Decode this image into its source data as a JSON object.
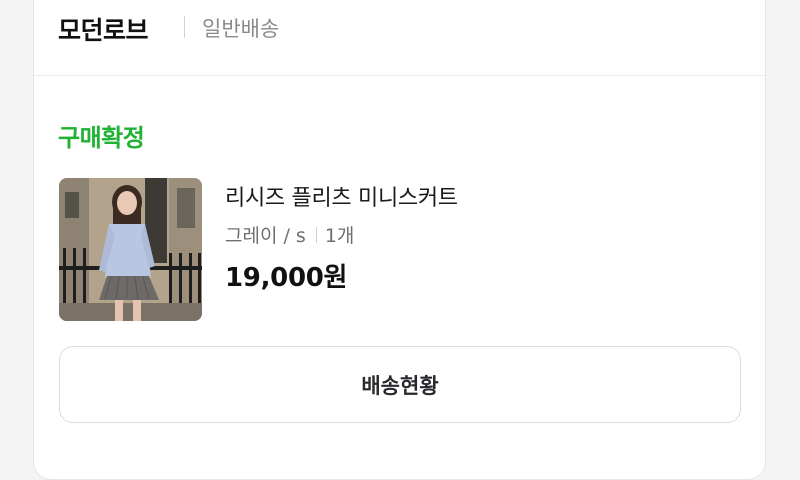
{
  "order": {
    "store_name": "모던로브",
    "delivery_type": "일반배송",
    "status": "구매확정",
    "status_color": "#1fb233",
    "product": {
      "name": "리시즈 플리츠 미니스커트",
      "option": "그레이 / s",
      "quantity": "1개",
      "price": "19,000원",
      "image_icon": "product-photo"
    },
    "track_button_label": "배송현황"
  }
}
